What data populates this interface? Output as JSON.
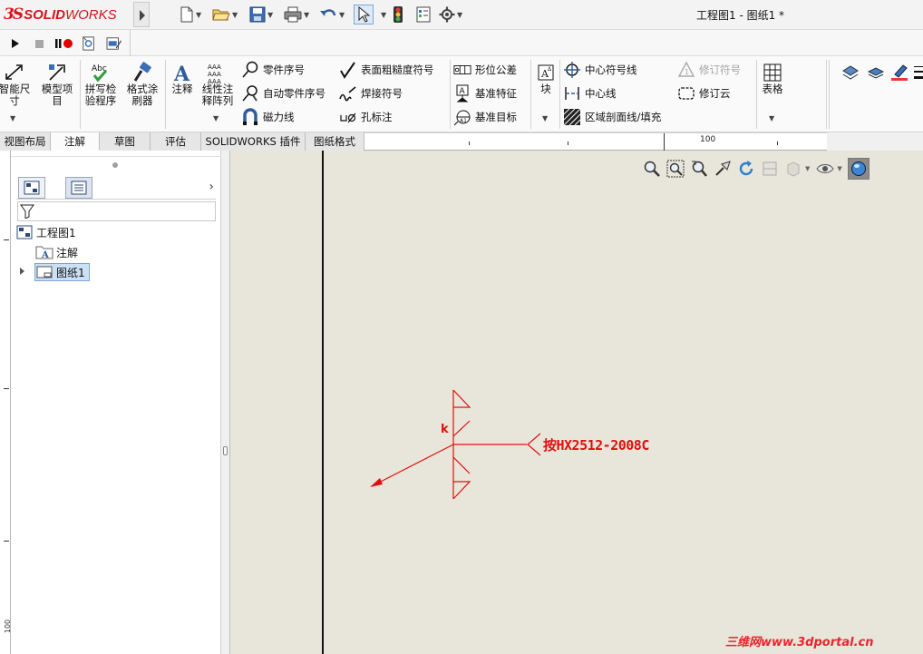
{
  "app": {
    "logo_prefix": "3S",
    "logo_brand_a": "SOLID",
    "logo_brand_b": "WORKS",
    "document_title": "工程图1 - 图纸1 *"
  },
  "command_manager": {
    "groups": [
      {
        "label": "智能尺\n寸",
        "icon": "smart-dimension-icon"
      },
      {
        "label": "模型项\n目",
        "icon": "model-items-icon"
      },
      {
        "label": "拼写检\n验程序",
        "icon": "spell-check-icon"
      },
      {
        "label": "格式涂\n刷器",
        "icon": "format-painter-icon"
      },
      {
        "label": "注释",
        "icon": "note-icon"
      },
      {
        "label": "线性注\n释阵列",
        "icon": "linear-note-pattern-icon"
      }
    ],
    "small_buttons": [
      {
        "label": "零件序号",
        "icon": "balloon-icon"
      },
      {
        "label": "自动零件序号",
        "icon": "auto-balloon-icon"
      },
      {
        "label": "磁力线",
        "icon": "magnetic-line-icon"
      },
      {
        "label": "表面粗糙度符号",
        "icon": "surface-finish-icon"
      },
      {
        "label": "焊接符号",
        "icon": "weld-symbol-icon"
      },
      {
        "label": "孔标注",
        "icon": "hole-callout-icon"
      },
      {
        "label": "形位公差",
        "icon": "geometric-tolerance-icon"
      },
      {
        "label": "基准特征",
        "icon": "datum-feature-icon"
      },
      {
        "label": "基准目标",
        "icon": "datum-target-icon"
      },
      {
        "label": "块",
        "icon": "block-icon"
      },
      {
        "label": "中心符号线",
        "icon": "center-mark-icon"
      },
      {
        "label": "中心线",
        "icon": "centerline-icon"
      },
      {
        "label": "区域剖面线/填充",
        "icon": "area-hatch-icon"
      },
      {
        "label": "修订符号",
        "icon": "revision-symbol-icon"
      },
      {
        "label": "修订云",
        "icon": "revision-cloud-icon"
      },
      {
        "label": "表格",
        "icon": "table-icon"
      }
    ]
  },
  "tabs": [
    {
      "label": "视图布局"
    },
    {
      "label": "注解"
    },
    {
      "label": "草图"
    },
    {
      "label": "评估"
    },
    {
      "label": "SOLIDWORKS 插件"
    },
    {
      "label": "图纸格式"
    }
  ],
  "active_tab": "注解",
  "ruler": {
    "top_label": "100",
    "side_label": "100"
  },
  "feature_tree": {
    "root": "工程图1",
    "items": [
      "注解",
      "图纸1"
    ],
    "selected": "图纸1"
  },
  "drawing": {
    "weld_note": "按HX2512-2008C",
    "weld_k": "k",
    "annotation_color": "#e01010"
  },
  "watermark": "三维网www.3dportal.cn",
  "colors": {
    "sheet_background": "#e8e6da",
    "brand_red": "#d5151d",
    "selection_blue": "#cce0f5"
  }
}
